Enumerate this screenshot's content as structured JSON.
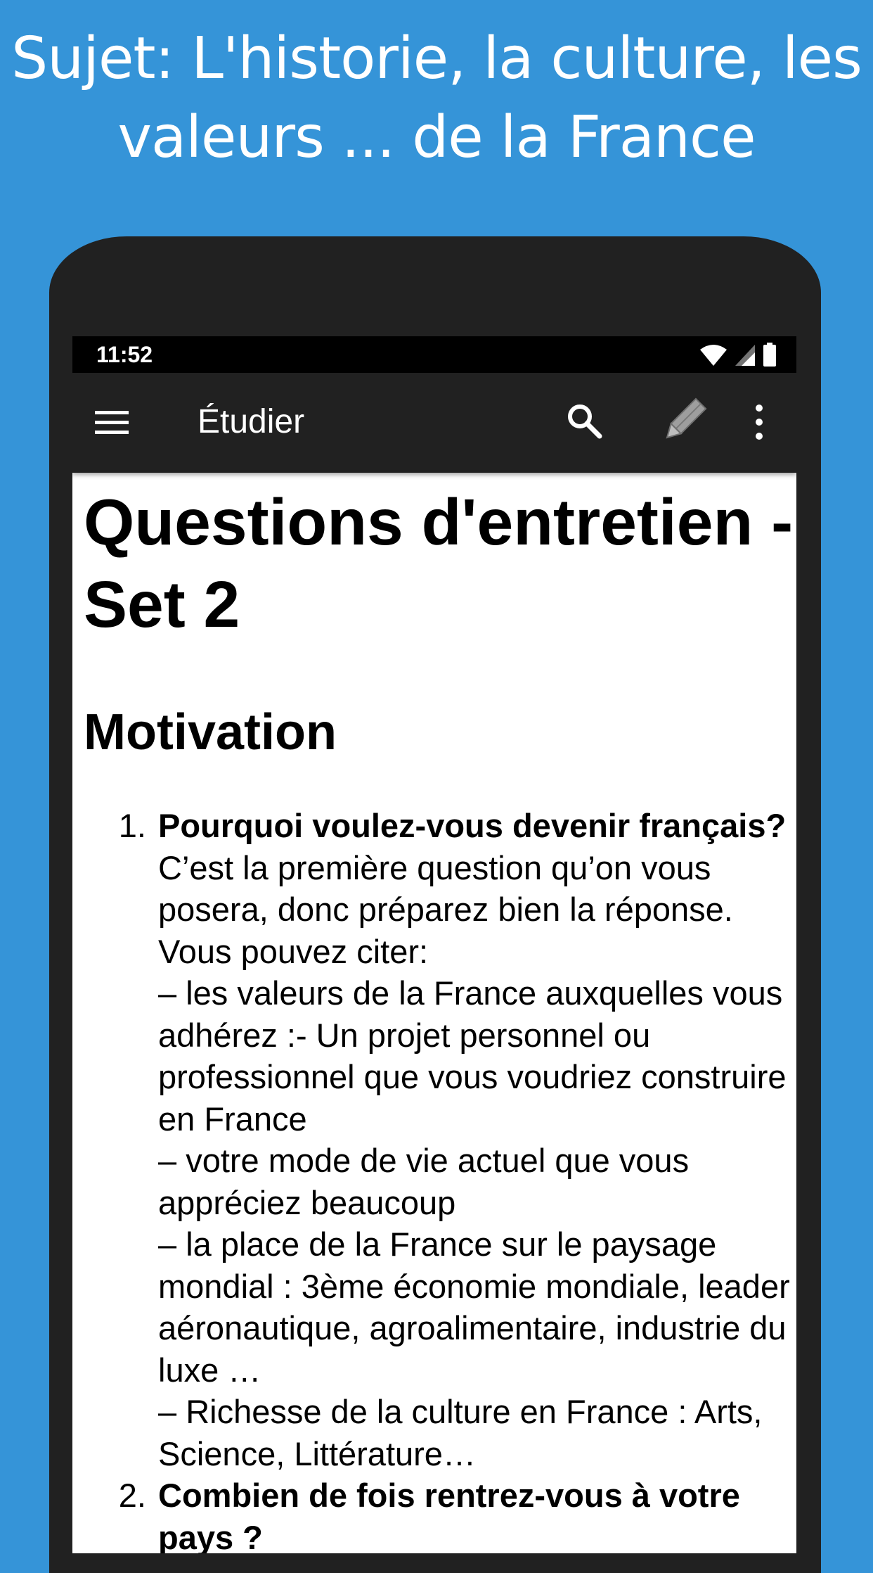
{
  "headline": {
    "line1": "Sujet: L'historie, la culture, les",
    "line2": "valeurs ... de la France"
  },
  "status_bar": {
    "time": "11:52",
    "icons": [
      "wifi-icon",
      "signal-icon",
      "battery-icon"
    ]
  },
  "app_bar": {
    "title": "Étudier",
    "icons": [
      "menu-icon",
      "search-icon",
      "pencil-icon",
      "more-vert-icon"
    ]
  },
  "article": {
    "title": "Questions d'entretien - Set 2",
    "section": "Motivation",
    "questions": [
      {
        "title": "Pourquoi voulez-vous devenir français?",
        "lines": [
          "C’est la première question qu’on vous posera, donc préparez bien la réponse. Vous pouvez citer:",
          "– les valeurs de la France auxquelles vous adhérez :- Un projet personnel ou professionnel que vous voudriez construire en France",
          "– votre mode de vie actuel que vous appréciez beaucoup",
          "– la place de la France sur le paysage mondial : 3ème économie mondiale, leader aéronautique, agroalimentaire, industrie du luxe …",
          "– Richesse de la culture en France : Arts, Science, Littérature…"
        ]
      },
      {
        "title": "Combien de fois rentrez-vous à votre pays ?",
        "lines": []
      }
    ]
  },
  "colors": {
    "background": "#3594d8",
    "phone_body": "#212121",
    "status_bar": "#000000",
    "app_bar": "#212121",
    "content_bg": "#ffffff"
  }
}
